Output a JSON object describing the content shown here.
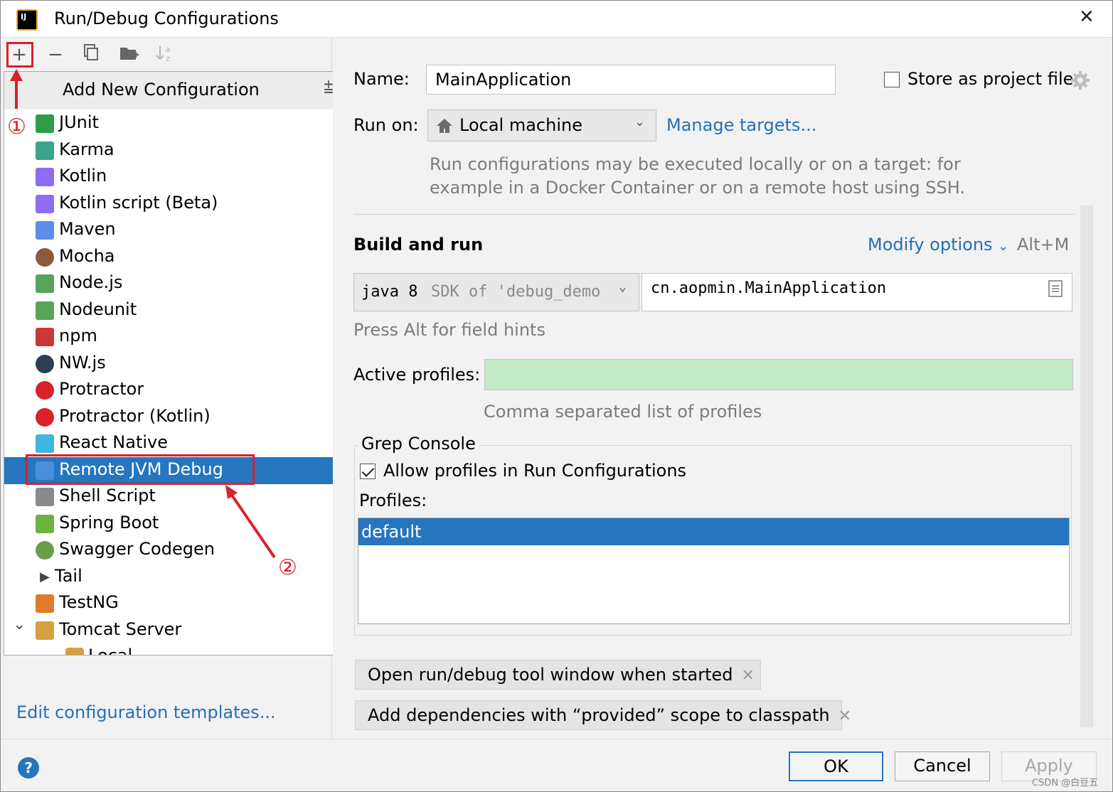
{
  "window": {
    "title": "Run/Debug Configurations",
    "app_icon": "IJ"
  },
  "annotations": {
    "step1": "①",
    "step2": "②",
    "color": "#d9202b"
  },
  "toolbar": {
    "add_icon": "+",
    "remove_icon": "−",
    "copy_icon": "copy-icon",
    "folder_icon": "new-folder-icon",
    "sort_icon": "sort-icon"
  },
  "popup": {
    "title": "Add New Configuration",
    "items": [
      {
        "label": "JUnit",
        "icon": "junit-icon"
      },
      {
        "label": "Karma",
        "icon": "karma-icon"
      },
      {
        "label": "Kotlin",
        "icon": "kotlin-icon"
      },
      {
        "label": "Kotlin script (Beta)",
        "icon": "kotlin-script-icon"
      },
      {
        "label": "Maven",
        "icon": "maven-icon"
      },
      {
        "label": "Mocha",
        "icon": "mocha-icon"
      },
      {
        "label": "Node.js",
        "icon": "nodejs-icon"
      },
      {
        "label": "Nodeunit",
        "icon": "nodeunit-icon"
      },
      {
        "label": "npm",
        "icon": "npm-icon"
      },
      {
        "label": "NW.js",
        "icon": "nwjs-icon"
      },
      {
        "label": "Protractor",
        "icon": "protractor-icon"
      },
      {
        "label": "Protractor (Kotlin)",
        "icon": "protractor-kotlin-icon"
      },
      {
        "label": "React Native",
        "icon": "react-icon"
      },
      {
        "label": "Remote JVM Debug",
        "icon": "remote-debug-icon",
        "selected": true
      },
      {
        "label": "Shell Script",
        "icon": "shell-icon"
      },
      {
        "label": "Spring Boot",
        "icon": "spring-boot-icon"
      },
      {
        "label": "Swagger Codegen",
        "icon": "swagger-icon"
      },
      {
        "label": "Tail",
        "icon": "chevron-right-icon"
      },
      {
        "label": "TestNG",
        "icon": "testng-icon"
      },
      {
        "label": "Tomcat Server",
        "icon": "tomcat-icon"
      },
      {
        "label": "Local",
        "icon": "tomcat-local-icon"
      }
    ]
  },
  "edit_templates_link": "Edit configuration templates...",
  "help": "?",
  "form": {
    "name_label": "Name:",
    "name_value": "MainApplication",
    "store_label": "Store as project file",
    "run_on_label": "Run on:",
    "run_on_value": "Local machine",
    "manage_targets": "Manage targets...",
    "run_on_hint_1": "Run configurations may be executed locally or on a target: for",
    "run_on_hint_2": "example in a Docker Container or on a remote host using SSH.",
    "build_and_run": "Build and run",
    "modify_options": "Modify options",
    "modify_shortcut": "Alt+M",
    "jdk_bold": "java 8",
    "jdk_rest": "SDK of 'debug_demo",
    "main_class": "cn.aopmin.MainApplication",
    "field_hint": "Press Alt for field hints",
    "active_profiles_label": "Active profiles:",
    "active_profiles_value": "",
    "active_profiles_bg": "#c3ebc5",
    "profiles_hint": "Comma separated list of profiles",
    "grep_console": "Grep Console",
    "allow_profiles": "Allow profiles in Run Configurations",
    "profiles_label": "Profiles:",
    "profiles_list": [
      "default"
    ],
    "option_tags": [
      "Open run/debug tool window when started",
      "Add dependencies with “provided” scope to classpath"
    ]
  },
  "buttons": {
    "ok": "OK",
    "cancel": "Cancel",
    "apply": "Apply"
  },
  "watermark": "CSDN @白豆五",
  "accent": "#2675bf"
}
